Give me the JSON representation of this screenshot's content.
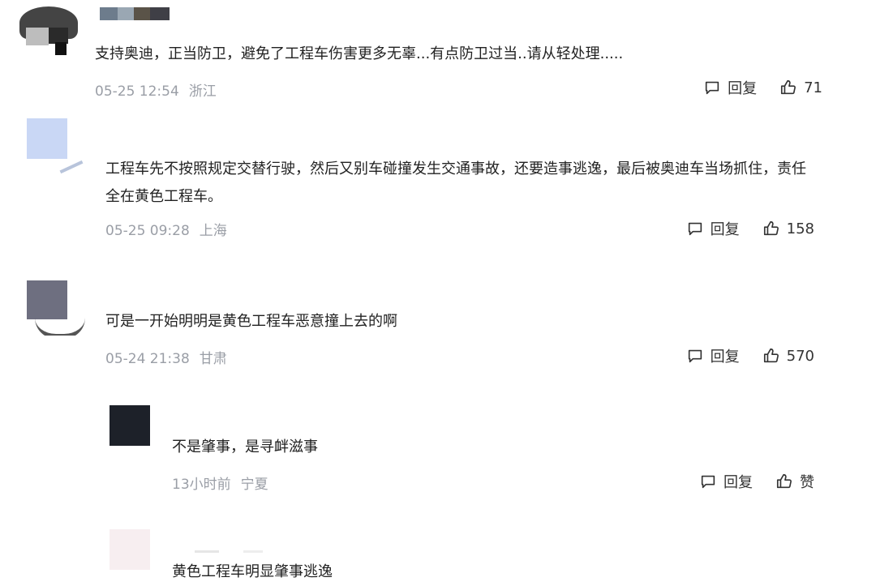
{
  "comments": [
    {
      "text": "支持奥迪，正当防卫，避免了工程车伤害更多无辜...有点防卫过当..请从轻处理.....",
      "date": "05-25 12:54",
      "location": "浙江",
      "reply_label": "回复",
      "likes": "71"
    },
    {
      "text": "工程车先不按照规定交替行驶，然后又别车碰撞发生交通事故，还要造事逃逸，最后被奥迪车当场抓住，责任全在黄色工程车。",
      "date": "05-25 09:28",
      "location": "上海",
      "reply_label": "回复",
      "likes": "158"
    },
    {
      "text": "可是一开始明明是黄色工程车恶意撞上去的啊",
      "date": "05-24 21:38",
      "location": "甘肃",
      "reply_label": "回复",
      "likes": "570"
    },
    {
      "text": "不是肇事，是寻衅滋事",
      "date": "13小时前",
      "location": "宁夏",
      "reply_label": "回复",
      "likes": "赞"
    },
    {
      "text": "黄色工程车明显肇事逃逸"
    }
  ],
  "icons": {
    "reply": "comment-bubble-icon",
    "like": "thumbs-up-icon"
  }
}
